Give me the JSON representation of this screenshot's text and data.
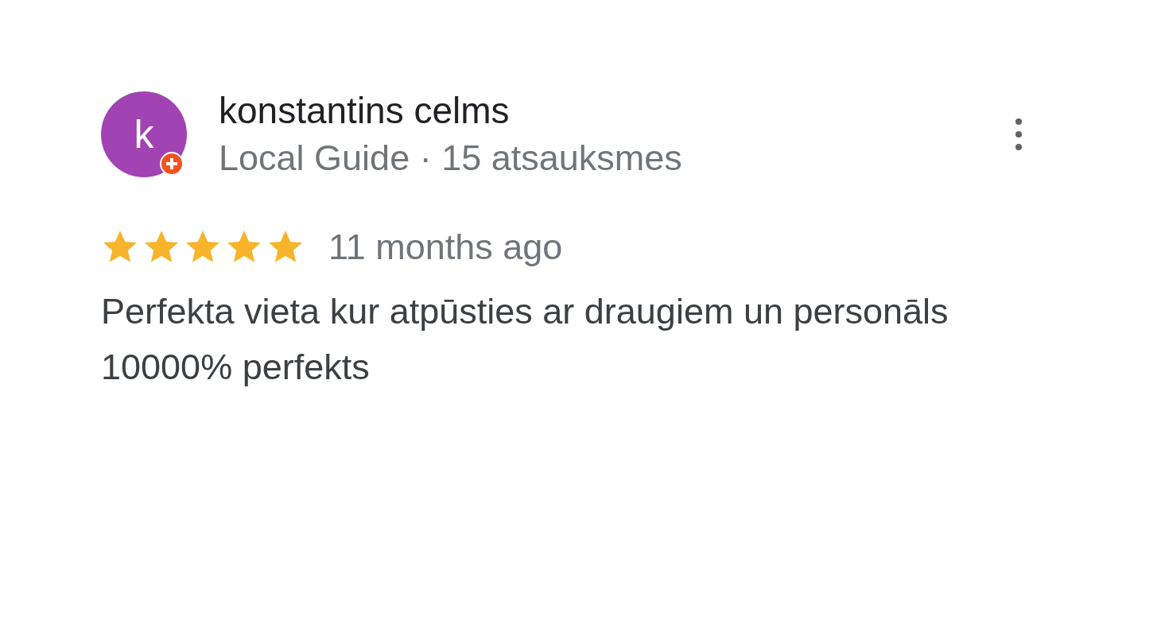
{
  "review": {
    "avatar_letter": "k",
    "local_guide": true,
    "author": "konstantins celms",
    "subtitle": "Local Guide · 15 atsauksmes",
    "stars": 5,
    "time": "11 months ago",
    "text": "Perfekta vieta kur atpūsties ar draugiem un personāls 10000% perfekts"
  }
}
